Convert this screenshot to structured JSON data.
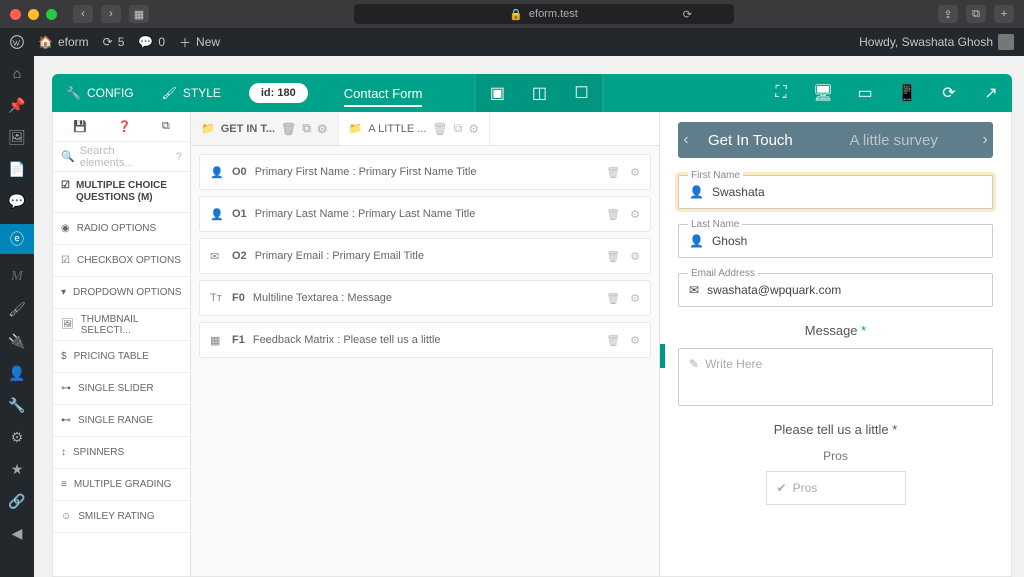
{
  "browser": {
    "url": "eform.test"
  },
  "wp": {
    "site": "eform",
    "updates": "5",
    "comments": "0",
    "new": "New",
    "howdy": "Howdy, Swashata Ghosh"
  },
  "toolbar": {
    "config": "CONFIG",
    "style": "STYLE",
    "id": "id: 180",
    "formName": "Contact Form"
  },
  "sidebar": {
    "searchPlaceholder": "Search elements...",
    "category": "MULTIPLE CHOICE QUESTIONS (M)",
    "items": [
      "RADIO OPTIONS",
      "CHECKBOX OPTIONS",
      "DROPDOWN OPTIONS",
      "THUMBNAIL SELECTI...",
      "PRICING TABLE",
      "SINGLE SLIDER",
      "SINGLE RANGE",
      "SPINNERS",
      "MULTIPLE GRADING",
      "SMILEY RATING"
    ]
  },
  "tabs": [
    {
      "label": "GET IN T..."
    },
    {
      "label": "A LITTLE ..."
    }
  ],
  "fields": [
    {
      "code": "O0",
      "text": "Primary First Name : Primary First Name Title"
    },
    {
      "code": "O1",
      "text": "Primary Last Name : Primary Last Name Title"
    },
    {
      "code": "O2",
      "text": "Primary Email : Primary Email Title"
    },
    {
      "code": "F0",
      "text": "Multiline Textarea : Message"
    },
    {
      "code": "F1",
      "text": "Feedback Matrix : Please tell us a little"
    }
  ],
  "preview": {
    "tab1": "Get In Touch",
    "tab2": "A little survey",
    "firstNameLabel": "First Name",
    "firstName": "Swashata",
    "lastNameLabel": "Last Name",
    "lastName": "Ghosh",
    "emailLabel": "Email Address",
    "email": "swashata@wpquark.com",
    "messageLabel": "Message",
    "messagePlaceholder": "Write Here",
    "matrixLabel": "Please tell us a little",
    "col1": "Pros",
    "row1": "Pros"
  }
}
